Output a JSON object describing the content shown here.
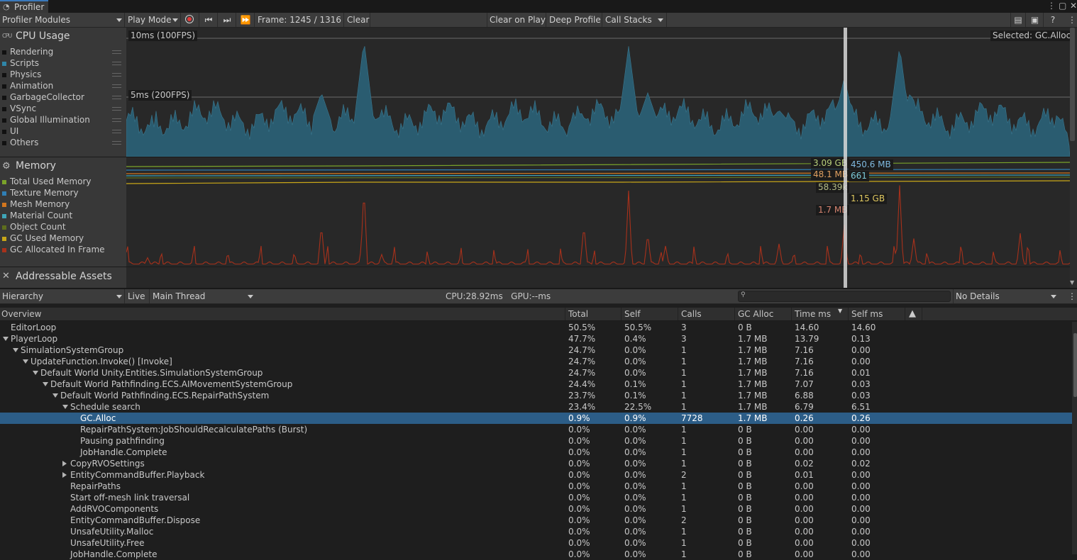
{
  "window": {
    "title": "Profiler"
  },
  "toolbar": {
    "modules_label": "Profiler Modules",
    "play_mode_label": "Play Mode",
    "frame_label": "Frame: 1245 / 1316",
    "clear_label": "Clear",
    "clear_on_play_label": "Clear on Play",
    "deep_profile_label": "Deep Profile",
    "call_stacks_label": "Call Stacks"
  },
  "cpu_module": {
    "title": "CPU Usage",
    "icon_text": "CPU",
    "items": [
      {
        "label": "Rendering",
        "color": "#111111"
      },
      {
        "label": "Scripts",
        "color": "#2f86a8"
      },
      {
        "label": "Physics",
        "color": "#111111"
      },
      {
        "label": "Animation",
        "color": "#111111"
      },
      {
        "label": "GarbageCollector",
        "color": "#111111"
      },
      {
        "label": "VSync",
        "color": "#111111"
      },
      {
        "label": "Global Illumination",
        "color": "#111111"
      },
      {
        "label": "UI",
        "color": "#111111"
      },
      {
        "label": "Others",
        "color": "#111111"
      }
    ],
    "line_10ms": "10ms (100FPS)",
    "line_5ms": "5ms (200FPS)",
    "selected_label": "Selected: GC.Alloc"
  },
  "memory_module": {
    "title": "Memory",
    "items": [
      {
        "label": "Total Used Memory",
        "color": "#7aa32a"
      },
      {
        "label": "Texture Memory",
        "color": "#2f7fb5"
      },
      {
        "label": "Mesh Memory",
        "color": "#d2761e"
      },
      {
        "label": "Material Count",
        "color": "#3fa6b8"
      },
      {
        "label": "Object Count",
        "color": "#5e6e1d"
      },
      {
        "label": "GC Used Memory",
        "color": "#c8a618"
      },
      {
        "label": "GC Allocated In Frame",
        "color": "#a8311b"
      }
    ],
    "readouts": {
      "total_used": "3.09 GB",
      "texture": "450.6 MB",
      "mesh": "48.1 MB",
      "material": "661",
      "object": "58.39k",
      "gc_used": "1.15 GB",
      "gc_alloc": "1.7 MB"
    }
  },
  "addressables_module": {
    "title": "Addressable Assets"
  },
  "hierarchy_toolbar": {
    "view_label": "Hierarchy",
    "live_label": "Live",
    "thread_label": "Main Thread",
    "cpu_gpu_label": "CPU:28.92ms   GPU:--ms",
    "details_label": "No Details"
  },
  "table": {
    "columns": [
      "Overview",
      "Total",
      "Self",
      "Calls",
      "GC Alloc",
      "Time ms",
      "Self ms"
    ],
    "rows": [
      {
        "name": "EditorLoop",
        "indent": 0,
        "expander": "none",
        "total": "50.5%",
        "self": "50.5%",
        "calls": "3",
        "gc": "0 B",
        "time": "14.60",
        "selfms": "14.60"
      },
      {
        "name": "PlayerLoop",
        "indent": 0,
        "expander": "down",
        "total": "47.7%",
        "self": "0.4%",
        "calls": "3",
        "gc": "1.7 MB",
        "time": "13.79",
        "selfms": "0.13"
      },
      {
        "name": "SimulationSystemGroup",
        "indent": 1,
        "expander": "down",
        "total": "24.7%",
        "self": "0.0%",
        "calls": "1",
        "gc": "1.7 MB",
        "time": "7.16",
        "selfms": "0.00"
      },
      {
        "name": "UpdateFunction.Invoke() [Invoke]",
        "indent": 2,
        "expander": "down",
        "total": "24.7%",
        "self": "0.0%",
        "calls": "1",
        "gc": "1.7 MB",
        "time": "7.16",
        "selfms": "0.00"
      },
      {
        "name": "Default World Unity.Entities.SimulationSystemGroup",
        "indent": 3,
        "expander": "down",
        "total": "24.7%",
        "self": "0.0%",
        "calls": "1",
        "gc": "1.7 MB",
        "time": "7.16",
        "selfms": "0.01"
      },
      {
        "name": "Default World Pathfinding.ECS.AIMovementSystemGroup",
        "indent": 4,
        "expander": "down",
        "total": "24.4%",
        "self": "0.1%",
        "calls": "1",
        "gc": "1.7 MB",
        "time": "7.07",
        "selfms": "0.03"
      },
      {
        "name": "Default World Pathfinding.ECS.RepairPathSystem",
        "indent": 5,
        "expander": "down",
        "total": "23.7%",
        "self": "0.1%",
        "calls": "1",
        "gc": "1.7 MB",
        "time": "6.88",
        "selfms": "0.03"
      },
      {
        "name": "Schedule search",
        "indent": 6,
        "expander": "down",
        "total": "23.4%",
        "self": "22.5%",
        "calls": "1",
        "gc": "1.7 MB",
        "time": "6.79",
        "selfms": "6.51"
      },
      {
        "name": "GC.Alloc",
        "indent": 7,
        "expander": "none",
        "selected": true,
        "total": "0.9%",
        "self": "0.9%",
        "calls": "7728",
        "gc": "1.7 MB",
        "time": "0.26",
        "selfms": "0.26"
      },
      {
        "name": "RepairPathSystem:JobShouldRecalculatePaths (Burst)",
        "indent": 7,
        "expander": "none",
        "total": "0.0%",
        "self": "0.0%",
        "calls": "1",
        "gc": "0 B",
        "time": "0.00",
        "selfms": "0.00"
      },
      {
        "name": "Pausing pathfinding",
        "indent": 7,
        "expander": "none",
        "total": "0.0%",
        "self": "0.0%",
        "calls": "1",
        "gc": "0 B",
        "time": "0.00",
        "selfms": "0.00"
      },
      {
        "name": "JobHandle.Complete",
        "indent": 7,
        "expander": "none",
        "total": "0.0%",
        "self": "0.0%",
        "calls": "1",
        "gc": "0 B",
        "time": "0.00",
        "selfms": "0.00"
      },
      {
        "name": "CopyRVOSettings",
        "indent": 6,
        "expander": "right",
        "total": "0.0%",
        "self": "0.0%",
        "calls": "1",
        "gc": "0 B",
        "time": "0.02",
        "selfms": "0.02"
      },
      {
        "name": "EntityCommandBuffer.Playback",
        "indent": 6,
        "expander": "right",
        "total": "0.0%",
        "self": "0.0%",
        "calls": "2",
        "gc": "0 B",
        "time": "0.01",
        "selfms": "0.00"
      },
      {
        "name": "RepairPaths",
        "indent": 6,
        "expander": "none",
        "total": "0.0%",
        "self": "0.0%",
        "calls": "1",
        "gc": "0 B",
        "time": "0.00",
        "selfms": "0.00"
      },
      {
        "name": "Start off-mesh link traversal",
        "indent": 6,
        "expander": "none",
        "total": "0.0%",
        "self": "0.0%",
        "calls": "1",
        "gc": "0 B",
        "time": "0.00",
        "selfms": "0.00"
      },
      {
        "name": "AddRVOComponents",
        "indent": 6,
        "expander": "none",
        "total": "0.0%",
        "self": "0.0%",
        "calls": "1",
        "gc": "0 B",
        "time": "0.00",
        "selfms": "0.00"
      },
      {
        "name": "EntityCommandBuffer.Dispose",
        "indent": 6,
        "expander": "none",
        "total": "0.0%",
        "self": "0.0%",
        "calls": "2",
        "gc": "0 B",
        "time": "0.00",
        "selfms": "0.00"
      },
      {
        "name": "UnsafeUtility.Malloc",
        "indent": 6,
        "expander": "none",
        "total": "0.0%",
        "self": "0.0%",
        "calls": "1",
        "gc": "0 B",
        "time": "0.00",
        "selfms": "0.00"
      },
      {
        "name": "UnsafeUtility.Free",
        "indent": 6,
        "expander": "none",
        "total": "0.0%",
        "self": "0.0%",
        "calls": "1",
        "gc": "0 B",
        "time": "0.00",
        "selfms": "0.00"
      },
      {
        "name": "JobHandle.Complete",
        "indent": 6,
        "expander": "none",
        "total": "0.0%",
        "self": "0.0%",
        "calls": "1",
        "gc": "0 B",
        "time": "0.00",
        "selfms": "0.00"
      }
    ]
  },
  "colors": {
    "selection": "#2c5d87",
    "scripts_area": "#2a5c70",
    "gc_line": "#a8311b"
  }
}
